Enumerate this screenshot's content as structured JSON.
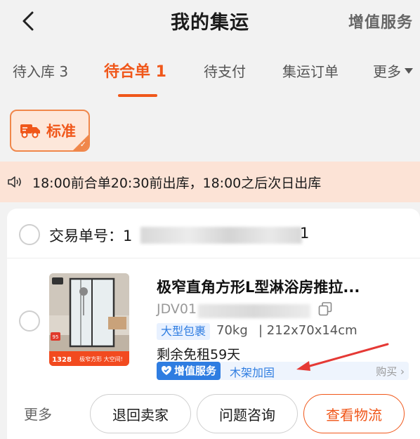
{
  "header": {
    "title": "我的集运",
    "right_link": "增值服务"
  },
  "tabs": [
    {
      "label": "待入库 3"
    },
    {
      "label": "待合单 1"
    },
    {
      "label": "待支付"
    },
    {
      "label": "集运订单"
    },
    {
      "label": "更多"
    }
  ],
  "mode_badge": {
    "label": "标准"
  },
  "notice": {
    "text": "18:00前合单20:30前出库，18:00之后次日出库"
  },
  "order": {
    "number_prefix": "交易单号：1",
    "number_suffix": "1",
    "product": {
      "title": "极窄直角方形L型淋浴房推拉...",
      "sku_prefix": "JDV01",
      "tag": "大型包裹",
      "weight": "70kg",
      "dimensions": "| 212x70x14cm",
      "rent": "剩余免租59天",
      "thumb_price": "1328",
      "thumb_slogan": "极窄方形 大空间!",
      "thumb_badge": "95"
    },
    "vas": {
      "tag": "增值服务",
      "item": "木架加固",
      "action": "购买"
    }
  },
  "actions": {
    "more": "更多",
    "return": "退回卖家",
    "consult": "问题咨询",
    "logistics": "查看物流"
  },
  "colors": {
    "accent": "#f0571a",
    "blue": "#2f7de1",
    "notice_bg": "#fce3d6"
  }
}
